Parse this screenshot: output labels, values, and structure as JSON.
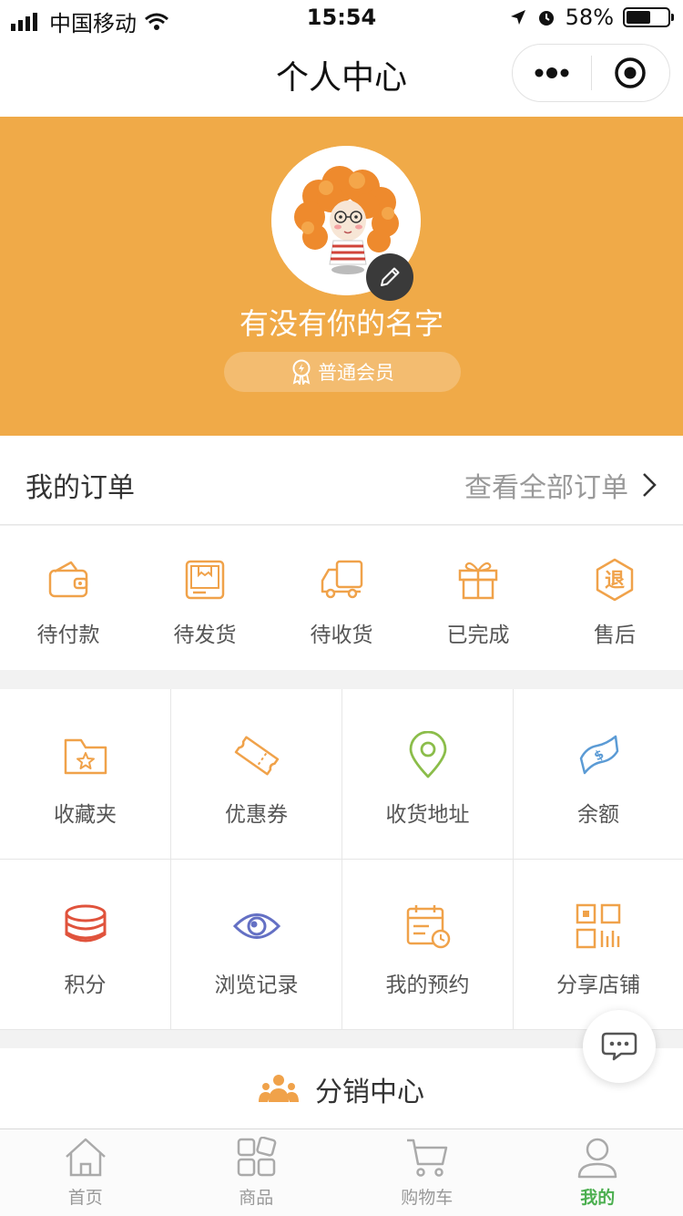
{
  "status_bar": {
    "carrier": "中国移动",
    "time": "15:54",
    "battery": "58%",
    "battery_level": 0.58
  },
  "nav": {
    "title": "个人中心"
  },
  "profile": {
    "username": "有没有你的名字",
    "member_level": "普通会员"
  },
  "orders": {
    "title": "我的订单",
    "view_all": "查看全部订单",
    "items": [
      {
        "label": "待付款",
        "icon": "wallet-icon"
      },
      {
        "label": "待发货",
        "icon": "package-icon"
      },
      {
        "label": "待收货",
        "icon": "truck-icon"
      },
      {
        "label": "已完成",
        "icon": "gift-icon"
      },
      {
        "label": "售后",
        "icon": "refund-icon",
        "glyph": "退"
      }
    ]
  },
  "services": [
    {
      "label": "收藏夹",
      "icon": "favorites-folder-icon"
    },
    {
      "label": "优惠券",
      "icon": "coupon-icon"
    },
    {
      "label": "收货地址",
      "icon": "location-pin-icon"
    },
    {
      "label": "余额",
      "icon": "balance-icon"
    },
    {
      "label": "积分",
      "icon": "points-coins-icon"
    },
    {
      "label": "浏览记录",
      "icon": "eye-icon"
    },
    {
      "label": "我的预约",
      "icon": "calendar-icon"
    },
    {
      "label": "分享店铺",
      "icon": "qr-code-icon"
    }
  ],
  "distribution": {
    "label": "分销中心"
  },
  "tabbar": [
    {
      "label": "首页",
      "icon": "home-icon"
    },
    {
      "label": "商品",
      "icon": "grid-icon"
    },
    {
      "label": "购物车",
      "icon": "cart-icon"
    },
    {
      "label": "我的",
      "icon": "user-icon",
      "active": true
    }
  ],
  "colors": {
    "accent_orange": "#f0aa48",
    "tab_active": "#4caf50",
    "icon_orange": "#f0a24a",
    "icon_green": "#8bbd4a",
    "icon_blue": "#5b9bd5",
    "icon_red": "#e0533c",
    "icon_purple": "#6470c4"
  }
}
